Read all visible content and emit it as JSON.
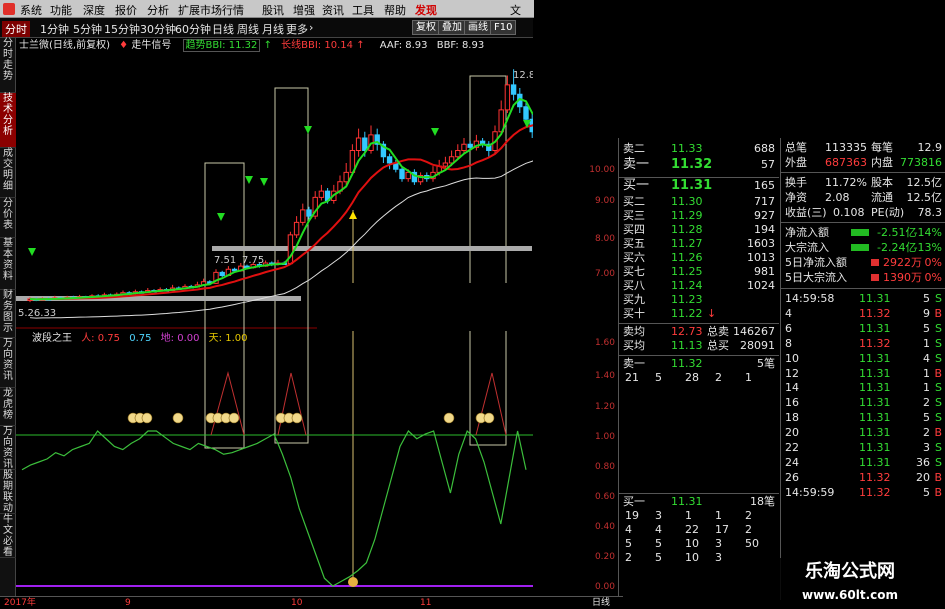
{
  "menu": {
    "items": [
      "系统",
      "功能",
      "深度",
      "报价",
      "分析",
      "扩展市场行情",
      "股讯",
      "增强",
      "资讯",
      "工具",
      "帮助"
    ],
    "highlight": "发现",
    "corner": "文"
  },
  "toolbar": {
    "periods": [
      "分时",
      "1分钟",
      "5分钟",
      "15分钟",
      "30分钟",
      "60分钟",
      "日线",
      "周线",
      "月线",
      "更多"
    ],
    "active": "分时",
    "more_arrow": "›",
    "buttons": [
      "复权",
      "叠加",
      "画线",
      "F10"
    ]
  },
  "vtabs": [
    "分时走势",
    "技术分析",
    "成交明细",
    "分价表",
    "基本资料",
    "财务图示",
    "万向资讯",
    "龙虎榜",
    "万向资讯",
    "股期联动",
    "牛文必看"
  ],
  "info": {
    "name": "士兰微(日线,前复权)",
    "signal": "走牛信号",
    "trend_label": "趋势BBI: 11.32",
    "trend_arrow": "↑",
    "long_label": "长线BBI: 10.14",
    "long_arrow": "↑",
    "aaf": "AAF: 8.93",
    "bbf": "BBF: 8.93"
  },
  "chart_labels": {
    "high": "12.80",
    "mid1": "7.51",
    "mid2": "7.75",
    "low": "5.26.33"
  },
  "indicator": {
    "name": "波段之王",
    "a_label": "人: 0.75",
    "b_label": "0.75",
    "c_label": "地: 0.00",
    "d_label": "天: 1.00"
  },
  "price_axis": [
    "10.00",
    "9.00",
    "8.00",
    "7.00",
    "1.60",
    "1.40",
    "1.20",
    "1.00",
    "0.80",
    "0.60",
    "0.40",
    "0.20",
    "0.00"
  ],
  "quote": {
    "sells": [
      {
        "label": "卖二",
        "price": "11.33",
        "vol": "688"
      },
      {
        "label": "卖一",
        "price": "11.32",
        "vol": "57"
      }
    ],
    "buys": [
      {
        "label": "买一",
        "price": "11.31",
        "vol": "165"
      },
      {
        "label": "买二",
        "price": "11.30",
        "vol": "717"
      },
      {
        "label": "买三",
        "price": "11.29",
        "vol": "927"
      },
      {
        "label": "买四",
        "price": "11.28",
        "vol": "194"
      },
      {
        "label": "买五",
        "price": "11.27",
        "vol": "1603"
      },
      {
        "label": "买六",
        "price": "11.26",
        "vol": "1013"
      },
      {
        "label": "买七",
        "price": "11.25",
        "vol": "981"
      },
      {
        "label": "买八",
        "price": "11.24",
        "vol": "1024"
      },
      {
        "label": "买九",
        "price": "11.23",
        "vol": ""
      },
      {
        "label": "买十",
        "price": "11.22",
        "vol": ""
      }
    ],
    "avg_sell": {
      "label": "卖均",
      "price": "12.73",
      "t": "总卖",
      "v": "146267"
    },
    "avg_buy": {
      "label": "买均",
      "price": "11.13",
      "t": "总买",
      "v": "28091"
    },
    "sell1_head": {
      "label": "卖一",
      "price": "11.32",
      "count": "5笔"
    },
    "sell1_queue": [
      "21",
      "5",
      "28",
      "2",
      "1"
    ],
    "buy1_head": {
      "label": "买一",
      "price": "11.31",
      "count": "18笔"
    },
    "buy1_queue": [
      [
        "19",
        "3",
        "1",
        "1",
        "2"
      ],
      [
        "4",
        "4",
        "22",
        "17",
        "2"
      ],
      [
        "5",
        "5",
        "10",
        "3",
        "50"
      ],
      [
        "2",
        "5",
        "10",
        "3",
        ""
      ]
    ]
  },
  "stats": {
    "rows": [
      [
        "总笔",
        "113335",
        "每笔",
        "12.9"
      ],
      [
        "外盘",
        "687363",
        "内盘",
        "773816"
      ],
      [
        "换手",
        "11.72%",
        "股本",
        "12.5亿"
      ],
      [
        "净资",
        "2.08",
        "流通",
        "12.5亿"
      ],
      [
        "收益(三)",
        "0.108",
        "PE(动)",
        "78.3"
      ],
      [
        "净流入额",
        "-2.51亿",
        "-14%",
        ""
      ],
      [
        "大宗流入",
        "-2.24亿",
        "-13%",
        ""
      ],
      [
        "5日净流入额",
        "2922万",
        "0%",
        ""
      ],
      [
        "5日大宗流入",
        "1390万",
        "0%",
        ""
      ]
    ],
    "ticks": [
      [
        "14:59:58",
        "11.31",
        "5",
        "S"
      ],
      [
        "4",
        "11.32",
        "9",
        "B"
      ],
      [
        "6",
        "11.31",
        "5",
        "S"
      ],
      [
        "8",
        "11.32",
        "1",
        "S"
      ],
      [
        "10",
        "11.31",
        "4",
        "S"
      ],
      [
        "12",
        "11.31",
        "1",
        "B"
      ],
      [
        "14",
        "11.31",
        "1",
        "S"
      ],
      [
        "16",
        "11.31",
        "2",
        "S"
      ],
      [
        "18",
        "11.31",
        "5",
        "S"
      ],
      [
        "20",
        "11.31",
        "2",
        "B"
      ],
      [
        "22",
        "11.31",
        "3",
        "S"
      ],
      [
        "24",
        "11.31",
        "36",
        "S"
      ],
      [
        "26",
        "11.32",
        "20",
        "B"
      ],
      [
        "14:59:59",
        "11.32",
        "5",
        "B"
      ]
    ]
  },
  "bottom": {
    "year": "2017年",
    "m1": "9",
    "m2": "10",
    "m3": "11",
    "period": "日线"
  },
  "brand": {
    "line1": "乐淘公式网",
    "line2": "www.60lt.com"
  },
  "chart_data": {
    "type": "candlestick",
    "title": "士兰微(日线,前复权)",
    "ylim": [
      5.0,
      13.0
    ],
    "candles": [
      [
        5.4,
        5.45,
        5.5,
        5.35
      ],
      [
        5.45,
        5.42,
        5.5,
        5.38
      ],
      [
        5.42,
        5.46,
        5.5,
        5.4
      ],
      [
        5.46,
        5.44,
        5.5,
        5.4
      ],
      [
        5.44,
        5.48,
        5.55,
        5.42
      ],
      [
        5.48,
        5.45,
        5.52,
        5.42
      ],
      [
        5.45,
        5.5,
        5.55,
        5.43
      ],
      [
        5.5,
        5.48,
        5.55,
        5.45
      ],
      [
        5.48,
        5.52,
        5.58,
        5.46
      ],
      [
        5.52,
        5.5,
        5.55,
        5.47
      ],
      [
        5.5,
        5.55,
        5.6,
        5.48
      ],
      [
        5.55,
        5.53,
        5.6,
        5.5
      ],
      [
        5.53,
        5.58,
        5.65,
        5.52
      ],
      [
        5.58,
        5.56,
        5.62,
        5.53
      ],
      [
        5.56,
        5.6,
        5.66,
        5.55
      ],
      [
        5.6,
        5.65,
        5.72,
        5.58
      ],
      [
        5.65,
        5.62,
        5.7,
        5.6
      ],
      [
        5.62,
        5.68,
        5.75,
        5.6
      ],
      [
        5.68,
        5.66,
        5.72,
        5.63
      ],
      [
        5.66,
        5.72,
        5.8,
        5.65
      ],
      [
        5.72,
        5.7,
        5.76,
        5.67
      ],
      [
        5.7,
        5.75,
        5.82,
        5.68
      ],
      [
        5.75,
        5.72,
        5.8,
        5.7
      ],
      [
        5.72,
        5.8,
        5.9,
        5.7
      ],
      [
        5.8,
        5.78,
        5.85,
        5.75
      ],
      [
        5.78,
        5.85,
        5.92,
        5.76
      ],
      [
        5.85,
        5.83,
        5.9,
        5.8
      ],
      [
        5.83,
        5.9,
        6.0,
        5.82
      ],
      [
        5.9,
        6.0,
        6.1,
        5.88
      ],
      [
        6.0,
        5.95,
        6.05,
        5.92
      ],
      [
        5.95,
        6.3,
        6.4,
        5.93
      ],
      [
        6.3,
        6.2,
        6.35,
        6.15
      ],
      [
        6.2,
        6.4,
        6.5,
        6.18
      ],
      [
        6.4,
        6.35,
        6.45,
        6.3
      ],
      [
        6.35,
        6.5,
        6.6,
        6.32
      ],
      [
        6.5,
        6.45,
        6.55,
        6.4
      ],
      [
        6.45,
        6.55,
        6.62,
        6.42
      ],
      [
        6.55,
        6.5,
        6.6,
        6.45
      ],
      [
        6.5,
        6.6,
        6.68,
        6.48
      ],
      [
        6.6,
        6.55,
        6.65,
        6.5
      ],
      [
        6.55,
        6.6,
        6.7,
        6.52
      ],
      [
        6.6,
        6.58,
        6.65,
        6.55
      ],
      [
        6.58,
        7.5,
        7.6,
        6.55
      ],
      [
        7.5,
        7.9,
        8.1,
        7.4
      ],
      [
        7.9,
        8.3,
        8.5,
        7.8
      ],
      [
        8.3,
        8.1,
        8.4,
        8.0
      ],
      [
        8.1,
        8.7,
        8.9,
        8.0
      ],
      [
        8.7,
        8.9,
        9.1,
        8.6
      ],
      [
        8.9,
        8.6,
        9.0,
        8.5
      ],
      [
        8.6,
        8.9,
        9.1,
        8.5
      ],
      [
        8.9,
        9.2,
        9.4,
        8.8
      ],
      [
        9.2,
        9.5,
        9.8,
        9.1
      ],
      [
        9.5,
        10.2,
        10.4,
        9.4
      ],
      [
        10.2,
        10.6,
        10.9,
        10.0
      ],
      [
        10.6,
        10.2,
        10.8,
        10.0
      ],
      [
        10.2,
        10.7,
        11.0,
        10.1
      ],
      [
        10.7,
        10.4,
        10.9,
        10.2
      ],
      [
        10.4,
        10.0,
        10.5,
        9.8
      ],
      [
        10.0,
        9.8,
        10.1,
        9.6
      ],
      [
        9.8,
        9.6,
        9.9,
        9.5
      ],
      [
        9.6,
        9.3,
        9.7,
        9.2
      ],
      [
        9.3,
        9.5,
        9.6,
        9.2
      ],
      [
        9.5,
        9.2,
        9.6,
        9.1
      ],
      [
        9.2,
        9.4,
        9.5,
        9.1
      ],
      [
        9.4,
        9.3,
        9.5,
        9.2
      ],
      [
        9.3,
        9.5,
        9.7,
        9.2
      ],
      [
        9.5,
        9.7,
        9.9,
        9.4
      ],
      [
        9.7,
        9.8,
        10.0,
        9.6
      ],
      [
        9.8,
        10.0,
        10.2,
        9.7
      ],
      [
        10.0,
        10.2,
        10.4,
        9.9
      ],
      [
        10.2,
        10.4,
        10.6,
        10.1
      ],
      [
        10.4,
        10.3,
        10.5,
        10.2
      ],
      [
        10.3,
        10.5,
        10.7,
        10.2
      ],
      [
        10.5,
        10.4,
        10.6,
        10.3
      ],
      [
        10.4,
        10.2,
        10.5,
        10.0
      ],
      [
        10.2,
        10.8,
        11.0,
        10.1
      ],
      [
        10.8,
        11.5,
        11.8,
        10.7
      ],
      [
        11.5,
        12.3,
        12.6,
        11.4
      ],
      [
        12.3,
        12.0,
        12.8,
        11.8
      ],
      [
        12.0,
        11.6,
        12.2,
        11.4
      ],
      [
        11.6,
        11.2,
        11.8,
        11.0
      ],
      [
        11.2,
        10.8,
        11.4,
        10.6
      ],
      [
        10.8,
        11.3,
        11.5,
        10.7
      ],
      [
        11.3,
        11.32,
        11.5,
        11.1
      ]
    ],
    "oscillator": [
      0.75,
      0.78,
      0.8,
      0.82,
      0.86,
      0.84,
      0.88,
      0.9,
      0.92,
      1.0,
      0.95,
      0.9,
      0.88,
      0.92,
      0.95,
      1.0,
      1.0,
      0.96,
      0.92,
      0.9,
      0.88,
      0.92,
      0.9,
      0.88,
      0.85,
      0.86,
      0.88,
      0.9,
      0.92,
      0.95,
      0.98,
      0.85,
      0.7,
      0.5,
      0.35,
      0.2,
      0.05,
      0.0,
      0.03,
      0.06,
      0.1,
      0.15,
      0.3,
      0.5,
      0.7,
      0.9,
      1.0,
      0.95,
      0.98,
      1.0,
      0.8,
      0.6,
      0.85,
      1.0,
      0.95,
      0.8,
      0.6,
      0.4,
      0.7,
      1.0,
      0.75
    ]
  }
}
